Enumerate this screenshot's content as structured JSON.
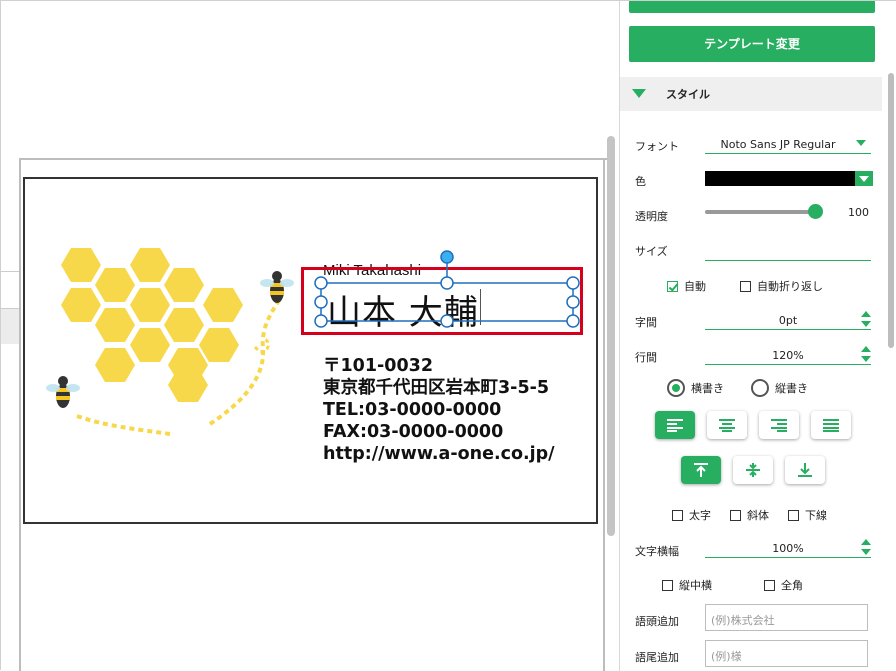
{
  "card": {
    "romaji": "Miki Takahashi",
    "name": "山本 大輔",
    "address_lines": [
      "〒101-0032",
      "東京都千代田区岩本町3-5-5",
      "TEL:03-0000-0000",
      "FAX:03-0000-0000",
      "http://www.a-one.co.jp/"
    ]
  },
  "panel": {
    "template_button": "テンプレート変更",
    "style_section": "スタイル",
    "font": {
      "label": "フォント",
      "value": "Noto Sans JP Regular"
    },
    "color": {
      "label": "色",
      "value": "#000000"
    },
    "opacity": {
      "label": "透明度",
      "value": "100",
      "fraction": 1.0
    },
    "size": {
      "label": "サイズ",
      "value": ""
    },
    "auto": {
      "label": "自動",
      "checked": true
    },
    "wrap": {
      "label": "自動折り返し",
      "checked": false
    },
    "char_spacing": {
      "label": "字間",
      "value": "0pt"
    },
    "line_spacing": {
      "label": "行間",
      "value": "120%"
    },
    "orientation": {
      "horizontal": "横書き",
      "vertical": "縦書き",
      "selected": "horizontal"
    },
    "align_buttons": [
      "align-left-icon",
      "align-center-icon",
      "align-right-icon",
      "align-justify-icon"
    ],
    "valign_buttons": [
      "align-top-icon",
      "align-middle-icon",
      "align-bottom-icon"
    ],
    "bold": {
      "label": "太字"
    },
    "italic": {
      "label": "斜体"
    },
    "underline": {
      "label": "下線"
    },
    "char_width": {
      "label": "文字横幅",
      "value": "100%"
    },
    "tate_chu_yoko": {
      "label": "縦中横"
    },
    "full_width": {
      "label": "全角"
    },
    "prefix": {
      "label": "語頭追加",
      "placeholder": "(例)株式会社"
    },
    "suffix": {
      "label": "語尾追加",
      "placeholder": "(例)様"
    }
  },
  "colors": {
    "accent": "#27ae60",
    "highlight": "#d6001c",
    "selection": "#1f6fbf",
    "honeycomb": "#f7d84a"
  }
}
